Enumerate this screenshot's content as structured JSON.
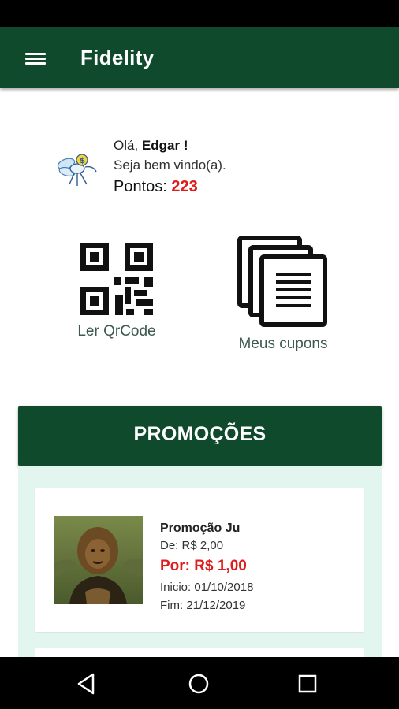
{
  "app": {
    "title": "Fidelity"
  },
  "icons": {
    "menu": "menu-icon",
    "avatar": "bee-mascot-icon",
    "qr": "qr-code-icon",
    "coupons": "coupons-stack-icon"
  },
  "colors": {
    "primary": "#0f4a2d",
    "accent_red": "#e01b1b",
    "promo_bg": "#e3f5ef"
  },
  "greeting": {
    "hello": "Olá,",
    "name": "Edgar !",
    "welcome": "Seja bem vindo(a).",
    "points_label": "Pontos:",
    "points_value": "223"
  },
  "actions": [
    {
      "label": "Ler QrCode"
    },
    {
      "label": "Meus cupons"
    }
  ],
  "promotions": {
    "header": "PROMOÇÕES",
    "items": [
      {
        "title": "Promoção Ju",
        "from": "De: R$ 2,00",
        "price": "Por: R$ 1,00",
        "start": "Inicio: 01/10/2018",
        "end": "Fim: 21/12/2019"
      }
    ]
  },
  "navbar": {
    "back": "back-icon",
    "home": "home-icon",
    "recent": "recent-apps-icon"
  }
}
